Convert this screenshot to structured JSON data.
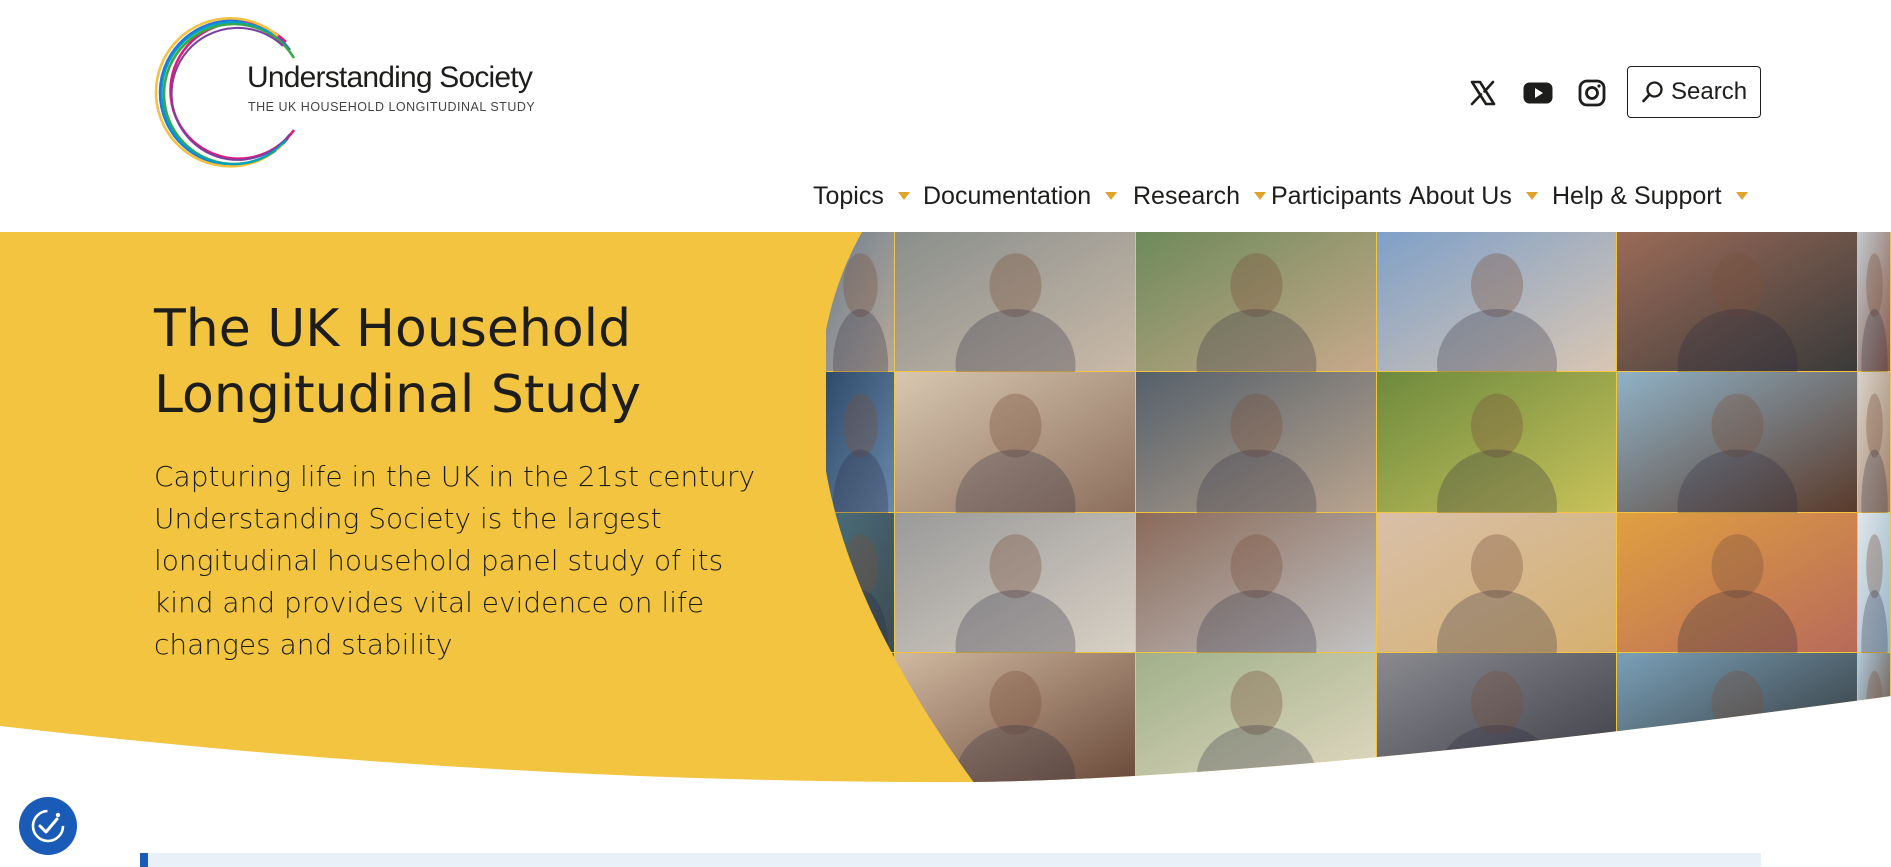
{
  "brand": {
    "name": "Understanding Society",
    "tagline": "THE UK HOUSEHOLD LONGITUDINAL STUDY",
    "ring_colors": [
      "#2a6fdb",
      "#e0197d",
      "#f2c240",
      "#3aa64a",
      "#7b3fa0",
      "#00a3c4"
    ]
  },
  "header": {
    "social": [
      {
        "name": "x-icon"
      },
      {
        "name": "youtube-icon"
      },
      {
        "name": "instagram-icon"
      }
    ],
    "search_label": "Search"
  },
  "nav": {
    "items": [
      {
        "label": "Topics",
        "has_dropdown": true
      },
      {
        "label": "Documentation",
        "has_dropdown": true
      },
      {
        "label": "Research",
        "has_dropdown": true
      },
      {
        "label": "Participants",
        "has_dropdown": false
      },
      {
        "label": "About Us",
        "has_dropdown": true
      },
      {
        "label": "Help & Support",
        "has_dropdown": true
      }
    ],
    "caret_color": "#e0a32e"
  },
  "hero": {
    "title": "The UK Household Longitudinal Study",
    "description": "Capturing life in the UK in the 21st century Understanding Society is the largest longitudinal household panel study of its kind and provides vital evidence on life changes and stability",
    "background_color": "#f2c440"
  },
  "accessibility": {
    "icon": "accessibility-icon",
    "color": "#1a5bb7"
  },
  "colors": {
    "accent_blue": "#1a5bb7",
    "accent_yellow": "#f2c440",
    "text": "#1d1d1b"
  }
}
